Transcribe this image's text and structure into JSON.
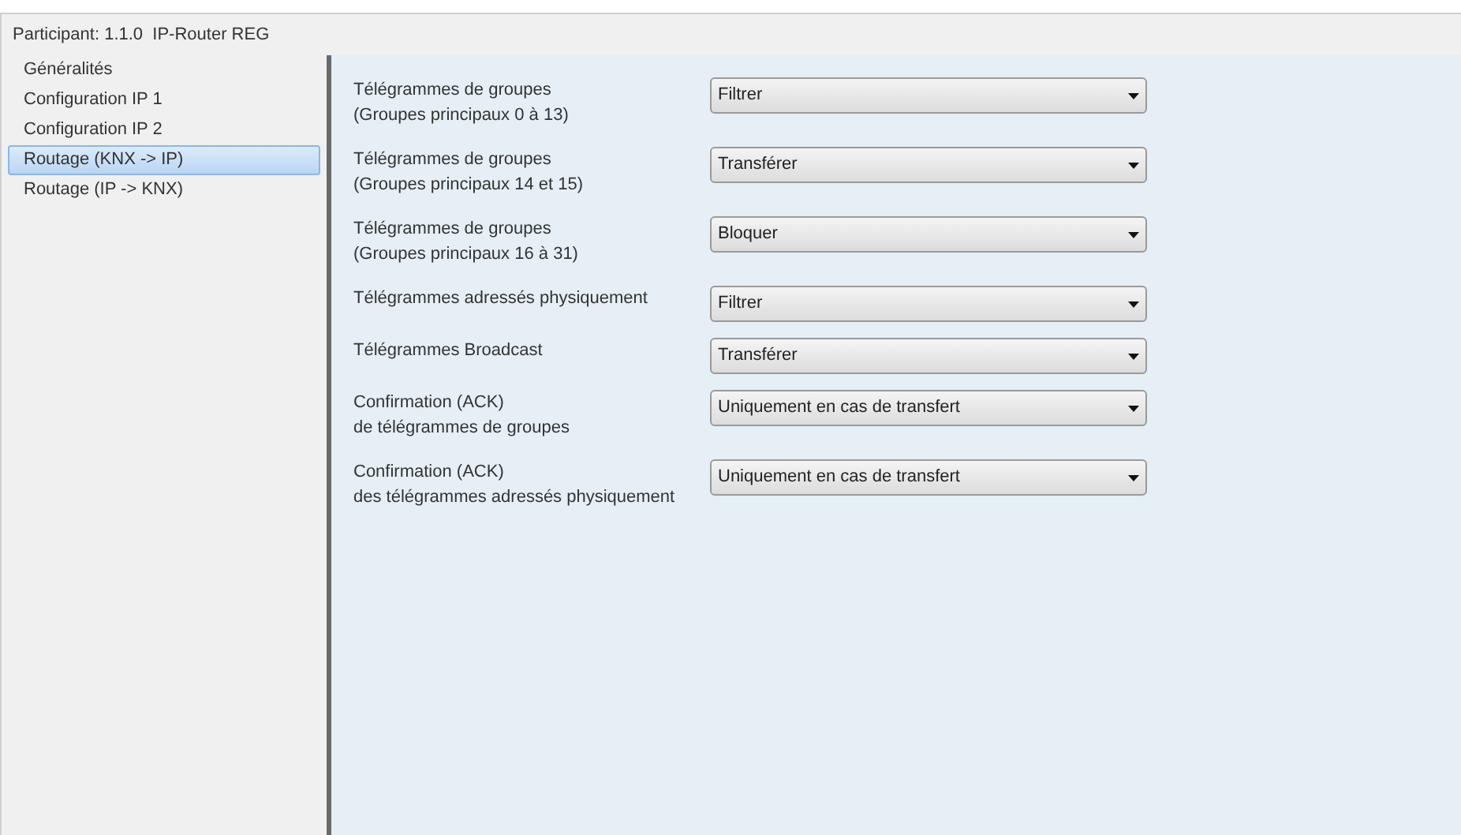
{
  "window": {
    "title": "Participant: 1.1.0  IP-Router REG"
  },
  "sidebar": {
    "items": [
      {
        "label": "Généralités",
        "selected": false
      },
      {
        "label": "Configuration IP 1",
        "selected": false
      },
      {
        "label": "Configuration IP 2",
        "selected": false
      },
      {
        "label": "Routage (KNX -> IP)",
        "selected": true
      },
      {
        "label": "Routage (IP -> KNX)",
        "selected": false
      }
    ]
  },
  "parameters": [
    {
      "label": [
        "Télégrammes de groupes",
        "(Groupes principaux 0 à 13)"
      ],
      "value": "Filtrer"
    },
    {
      "label": [
        "Télégrammes de groupes",
        "(Groupes principaux 14 et 15)"
      ],
      "value": "Transférer"
    },
    {
      "label": [
        "Télégrammes de groupes",
        "(Groupes principaux 16 à 31)"
      ],
      "value": "Bloquer"
    },
    {
      "label": [
        "Télégrammes adressés physiquement"
      ],
      "value": "Filtrer"
    },
    {
      "label": [
        "Télégrammes Broadcast"
      ],
      "value": "Transférer"
    },
    {
      "label": [
        "Confirmation (ACK)",
        "de télégrammes de groupes"
      ],
      "value": "Uniquement en cas de transfert"
    },
    {
      "label": [
        "Confirmation (ACK)",
        "des télégrammes adressés physiquement"
      ],
      "value": "Uniquement en cas de transfert"
    }
  ]
}
